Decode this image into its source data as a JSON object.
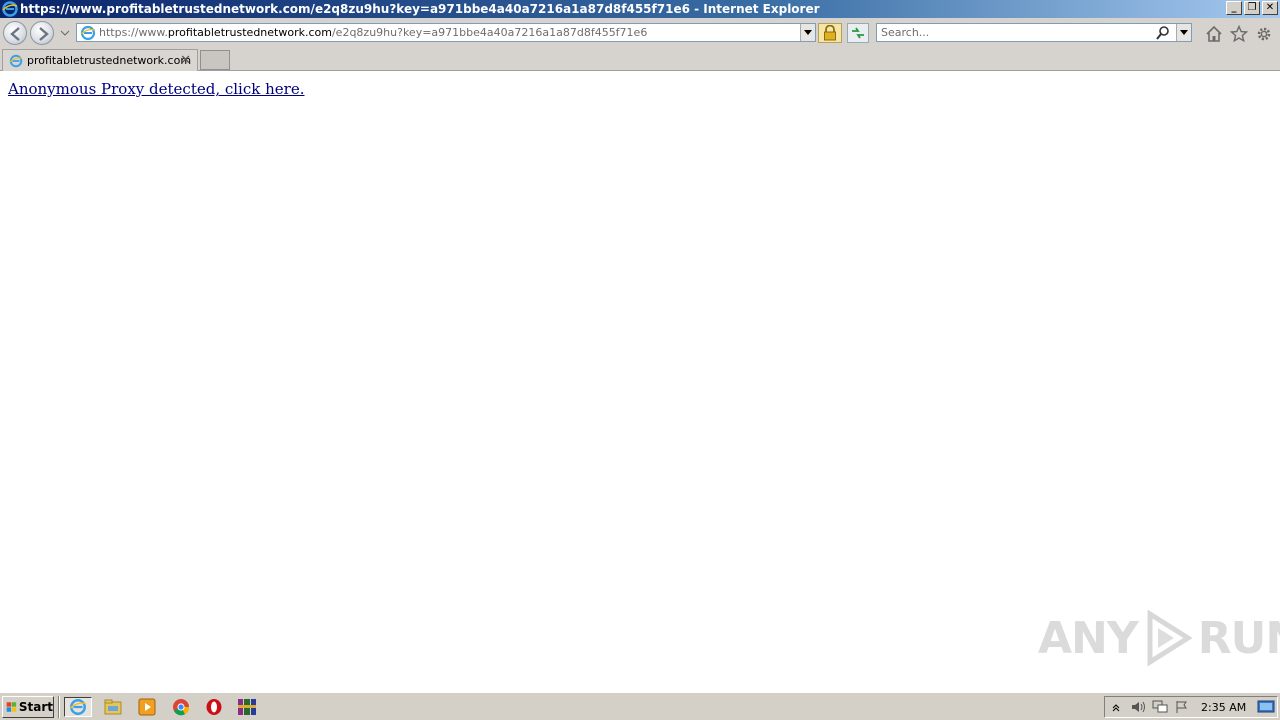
{
  "window": {
    "title": "https://www.profitabletrustednetwork.com/e2q8zu9hu?key=a971bbe4a40a7216a1a87d8f455f71e6 - Internet Explorer",
    "minimize": "_",
    "restore": "❐",
    "close": "✕"
  },
  "address": {
    "scheme": "https://",
    "host_prefix": "www.",
    "domain": "profitabletrustednetwork.com",
    "path": "/e2q8zu9hu?key=a971bbe4a40a7216a1a87d8f455f71e6"
  },
  "search": {
    "placeholder": "Search..."
  },
  "tabs": [
    {
      "label": "profitabletrustednetwork.com",
      "close": "✕"
    }
  ],
  "page": {
    "link_text": "Anonymous Proxy detected, click here."
  },
  "watermark": {
    "left": "ANY",
    "right": "RUN"
  },
  "taskbar": {
    "start_label": "Start",
    "clock": "2:35 AM"
  },
  "colors": {
    "link": "#00007f",
    "titlebar_start": "#0a246a",
    "titlebar_end": "#a6caf0",
    "chrome": "#d6d3ce"
  },
  "icons": [
    "ie-logo-icon",
    "back-icon",
    "forward-icon",
    "lock-icon",
    "refresh-icon",
    "search-icon",
    "home-icon",
    "star-icon",
    "gear-icon",
    "windows-flag-icon",
    "explorer-icon",
    "media-player-icon",
    "chrome-icon",
    "opera-icon",
    "winrar-icon",
    "volume-icon",
    "network-icon",
    "flag-icon"
  ]
}
